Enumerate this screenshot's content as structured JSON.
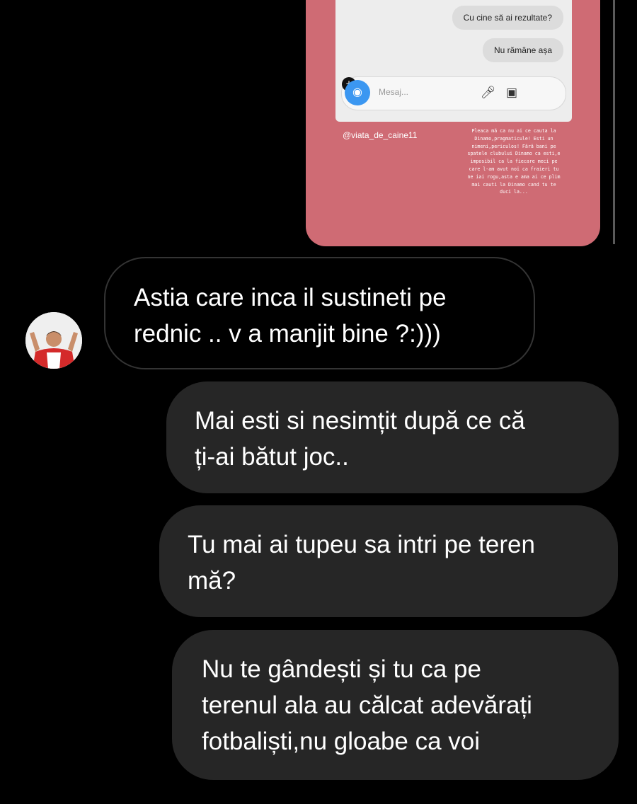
{
  "story": {
    "messages": [
      "Cu cine să ai rezultate?",
      "Nu rămâne așa"
    ],
    "compose_placeholder": "Mesaj...",
    "handle": "@viata_de_caine11",
    "body_text": "Pleaca mă ca nu ai ce cauta la Dinamo,pragmaticule! Esti un nimeni,periculos! Fără bani pe spatele clubului Dinamo ca esti,e imposibil ca la fiecare meci pe care l-am avut noi ca fraieri tu ne iai rogu,asta e ama ai ce plim mai cauti la Dinamo cand tu te duci la..."
  },
  "chat": {
    "received": {
      "lines": [
        "Astia care inca il sustineti pe",
        "rednic .. v a manjit bine ?:)))"
      ]
    },
    "sent": [
      {
        "lines": [
          "Mai esti si nesimțit după ce că",
          "ți-ai bătut joc.."
        ]
      },
      {
        "lines": [
          "Tu mai ai tupeu sa intri pe teren",
          "mă?"
        ]
      },
      {
        "lines": [
          "Nu te gândești și tu ca pe",
          "terenul ala au călcat adevărați",
          "fotbaliști,nu gloabe ca voi"
        ]
      }
    ]
  },
  "colors": {
    "background": "#000000",
    "story_card": "#cf6b74",
    "sent_bubble": "#262626",
    "received_border": "#343434",
    "camera_button": "#3b97f1"
  },
  "icons": {
    "camera": "camera-icon",
    "mic": "microphone-icon",
    "gallery": "gallery-icon",
    "plus": "plus-icon"
  }
}
